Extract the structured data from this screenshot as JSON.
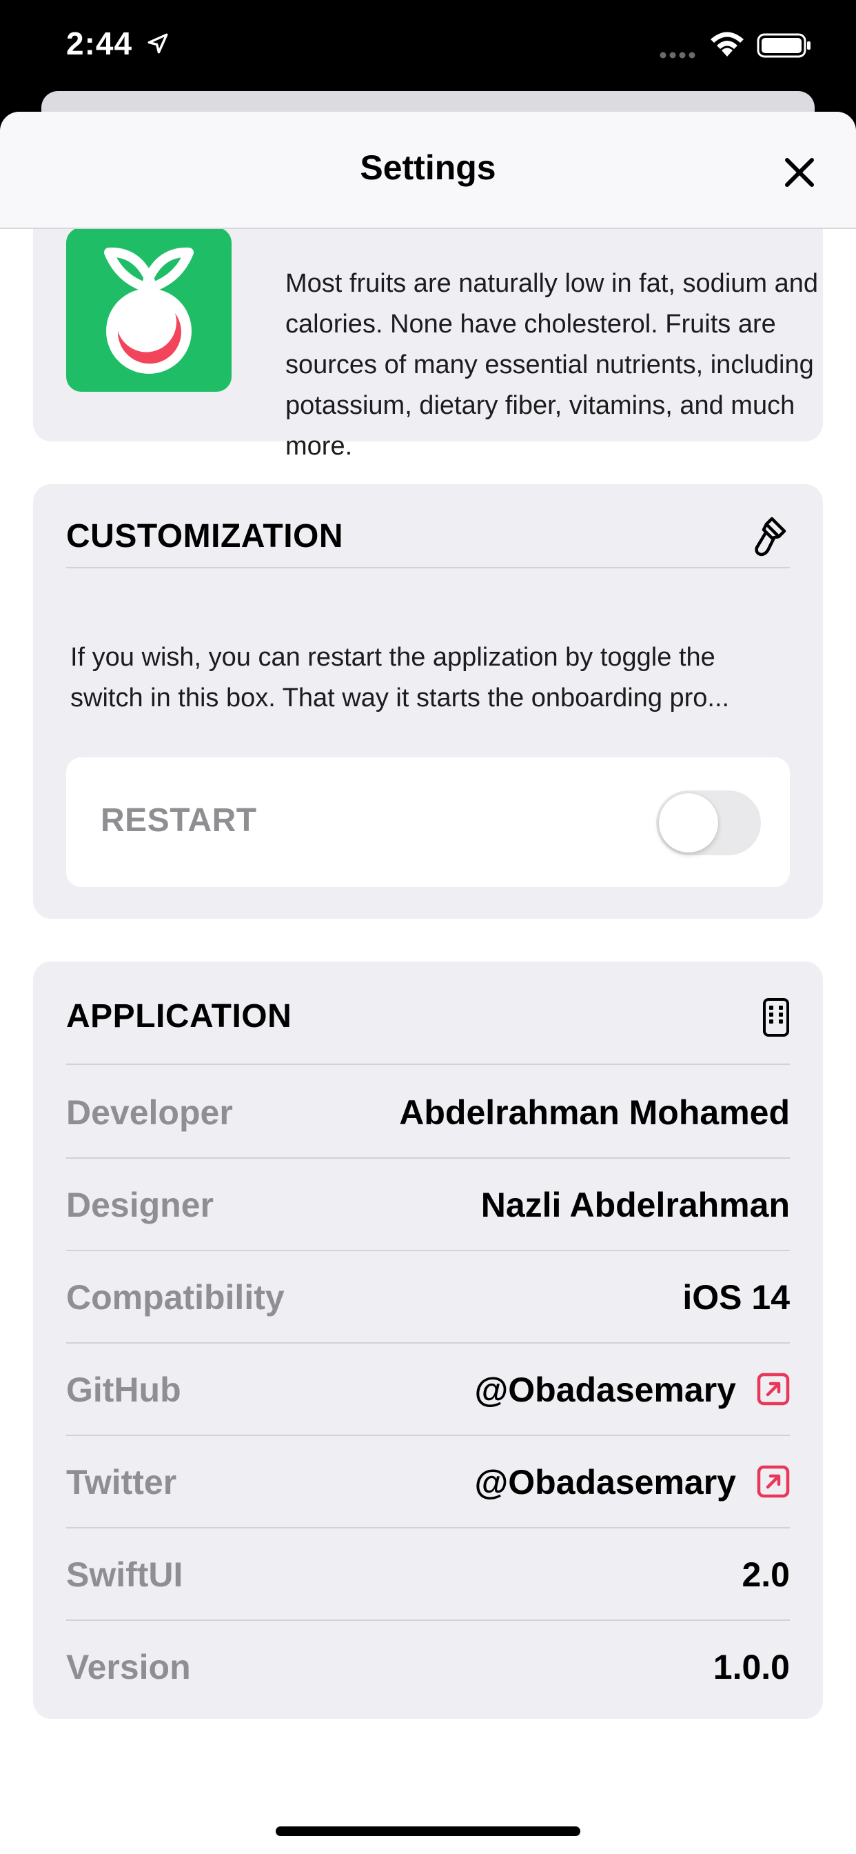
{
  "status_bar": {
    "time": "2:44",
    "location_icon": "location-arrow-icon",
    "signal_icon": "cellular-signal-icon",
    "wifi_icon": "wifi-icon",
    "battery_icon": "battery-icon"
  },
  "nav": {
    "title": "Settings",
    "close_icon": "close-icon"
  },
  "about": {
    "logo_icon": "fruit-logo-icon",
    "text": "Most fruits are naturally low in fat, sodium and calories. None have cholesterol. Fruits are sources of many essential nutrients, including potassium, dietary fiber, vitamins, and much more."
  },
  "customization": {
    "title": "CUSTOMIZATION",
    "icon": "paintbrush-icon",
    "description_line1": "If you wish, you can restart the applization by toggle the",
    "description_line2": "switch in this box. That way it starts the onboarding pro...",
    "restart_label": "RESTART",
    "restart_on": false
  },
  "application": {
    "title": "APPLICATION",
    "icon": "apps-iphone-icon",
    "rows": [
      {
        "label": "Developer",
        "value": "Abdelrahman Mohamed"
      },
      {
        "label": "Designer",
        "value": "Nazli Abdelrahman"
      },
      {
        "label": "Compatibility",
        "value": "iOS 14"
      },
      {
        "label": "GitHub",
        "value": "@Obadasemary"
      },
      {
        "label": "Twitter",
        "value": "@Obadasemary"
      },
      {
        "label": "SwiftUI",
        "value": "2.0"
      },
      {
        "label": "Version",
        "value": "1.0.0"
      }
    ]
  },
  "colors": {
    "accent": "#e8385a",
    "logo_green": "#1fbe66",
    "box_background": "#efeff3",
    "secondary_text": "#8e8e93"
  }
}
